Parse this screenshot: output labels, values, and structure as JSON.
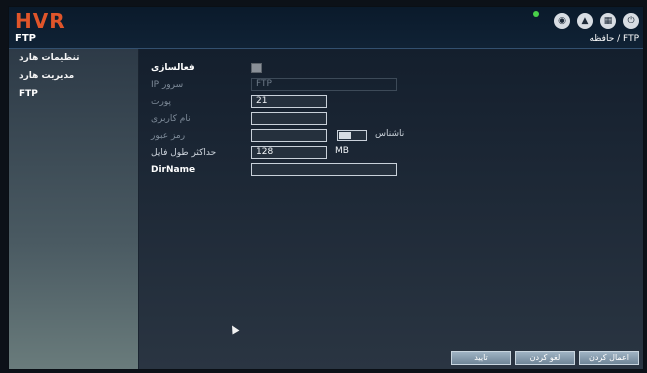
{
  "app": {
    "logo": "HVR",
    "title": "FTP"
  },
  "breadcrumb": "حافظه / FTP",
  "top_icons": [
    {
      "name": "camera-icon",
      "glyph": "◉"
    },
    {
      "name": "alarm-icon",
      "glyph": "▲"
    },
    {
      "name": "grid-icon",
      "glyph": "▦"
    },
    {
      "name": "power-icon",
      "glyph": "⏻"
    }
  ],
  "sidebar": {
    "items": [
      {
        "label": "تنظیمات هارد"
      },
      {
        "label": "مدیریت هارد"
      },
      {
        "label": "FTP"
      }
    ]
  },
  "form": {
    "enable_label": "فعالسازی",
    "ip_label": "سرور IP",
    "ip_value": "FTP",
    "port_label": "پورت",
    "port_value": "21",
    "username_label": "نام کاربری",
    "username_value": "",
    "password_label": "رمز عبور",
    "password_value": "",
    "anonymous_label": "ناشناس",
    "max_file_label": "حداکثر طول فایل",
    "max_file_value": "128",
    "max_file_unit": "MB",
    "dirname_label": "DirName",
    "dirname_value": ""
  },
  "buttons": {
    "confirm": "تایید",
    "cancel": "لغو کردن",
    "apply": "اعمال کردن"
  }
}
